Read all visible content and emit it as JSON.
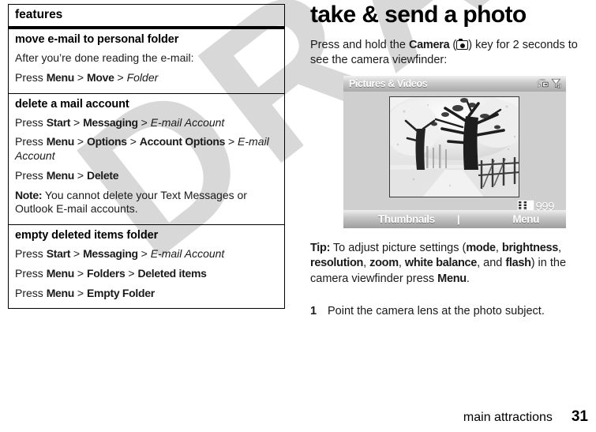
{
  "watermark": {
    "text": "DRAFT"
  },
  "features_table": {
    "header_label": "features",
    "sections": [
      {
        "title": "move e-mail to personal folder",
        "lines": [
          {
            "parts": [
              {
                "t": "After you’re done reading the e-mail:",
                "s": "n"
              }
            ]
          },
          {
            "parts": [
              {
                "t": "Press ",
                "s": "n"
              },
              {
                "t": "Menu",
                "s": "b"
              },
              {
                "t": " > ",
                "s": "g"
              },
              {
                "t": "Move",
                "s": "b"
              },
              {
                "t": " > ",
                "s": "g"
              },
              {
                "t": "Folder",
                "s": "i"
              }
            ]
          }
        ]
      },
      {
        "title": "delete a mail account",
        "lines": [
          {
            "parts": [
              {
                "t": "Press ",
                "s": "n"
              },
              {
                "t": "Start",
                "s": "b"
              },
              {
                "t": " > ",
                "s": "g"
              },
              {
                "t": "Messaging",
                "s": "b"
              },
              {
                "t": " > ",
                "s": "g"
              },
              {
                "t": "E-mail Account",
                "s": "i"
              }
            ]
          },
          {
            "parts": [
              {
                "t": "Press ",
                "s": "n"
              },
              {
                "t": "Menu",
                "s": "b"
              },
              {
                "t": " > ",
                "s": "g"
              },
              {
                "t": "Options",
                "s": "b"
              },
              {
                "t": " > ",
                "s": "g"
              },
              {
                "t": "Account Options",
                "s": "b"
              },
              {
                "t": " > ",
                "s": "g"
              },
              {
                "t": "E-mail Account",
                "s": "i"
              }
            ]
          },
          {
            "parts": [
              {
                "t": "Press ",
                "s": "n"
              },
              {
                "t": "Menu",
                "s": "b"
              },
              {
                "t": " > ",
                "s": "g"
              },
              {
                "t": "Delete",
                "s": "b"
              }
            ]
          },
          {
            "parts": [
              {
                "t": "Note:",
                "s": "b"
              },
              {
                "t": " You cannot delete your Text Messages or Outlook E-mail accounts.",
                "s": "n"
              }
            ]
          }
        ]
      },
      {
        "title": "empty deleted items folder",
        "lines": [
          {
            "parts": [
              {
                "t": "Press ",
                "s": "n"
              },
              {
                "t": "Start",
                "s": "b"
              },
              {
                "t": " > ",
                "s": "g"
              },
              {
                "t": "Messaging",
                "s": "b"
              },
              {
                "t": " > ",
                "s": "g"
              },
              {
                "t": "E-mail Account",
                "s": "i"
              }
            ]
          },
          {
            "parts": [
              {
                "t": "Press ",
                "s": "n"
              },
              {
                "t": "Menu",
                "s": "b"
              },
              {
                "t": " > ",
                "s": "g"
              },
              {
                "t": "Folders",
                "s": "b"
              },
              {
                "t": " > ",
                "s": "g"
              },
              {
                "t": "Deleted items",
                "s": "b"
              }
            ]
          },
          {
            "parts": [
              {
                "t": "Press ",
                "s": "n"
              },
              {
                "t": "Menu",
                "s": "b"
              },
              {
                "t": " > ",
                "s": "g"
              },
              {
                "t": "Empty Folder",
                "s": "b"
              }
            ]
          }
        ]
      }
    ]
  },
  "right_column": {
    "heading": "take & send a photo",
    "intro": {
      "before_bold": "Press and hold the ",
      "bold": "Camera",
      "between": " (",
      "icon": "camera-icon",
      "after_icon": ") key for 2 seconds to see the camera viewfinder:"
    },
    "phone": {
      "title": "Pictures & Videos",
      "status_icons": [
        "sync-icon",
        "signal-icon"
      ],
      "shot_counter": "999",
      "softkey_left": "Thumbnails",
      "softkey_center": "|",
      "softkey_right": "Menu"
    },
    "tip": {
      "label": "Tip:",
      "text_1": " To adjust picture settings (",
      "b1": "mode",
      "sep1": ", ",
      "b2": "brightness",
      "sep2": ", ",
      "b3": "resolution",
      "sep3": ", ",
      "b4": "zoom",
      "sep4": ", ",
      "b5": "white balance",
      "sep5": ", and ",
      "b6": "flash",
      "text_2": ") in the camera viewfinder press ",
      "b7": "Menu",
      "text_3": "."
    },
    "steps": [
      {
        "num": "1",
        "text": "Point the camera lens at the photo subject."
      }
    ]
  },
  "footer": {
    "chapter": "main attractions",
    "page_number": "31"
  }
}
